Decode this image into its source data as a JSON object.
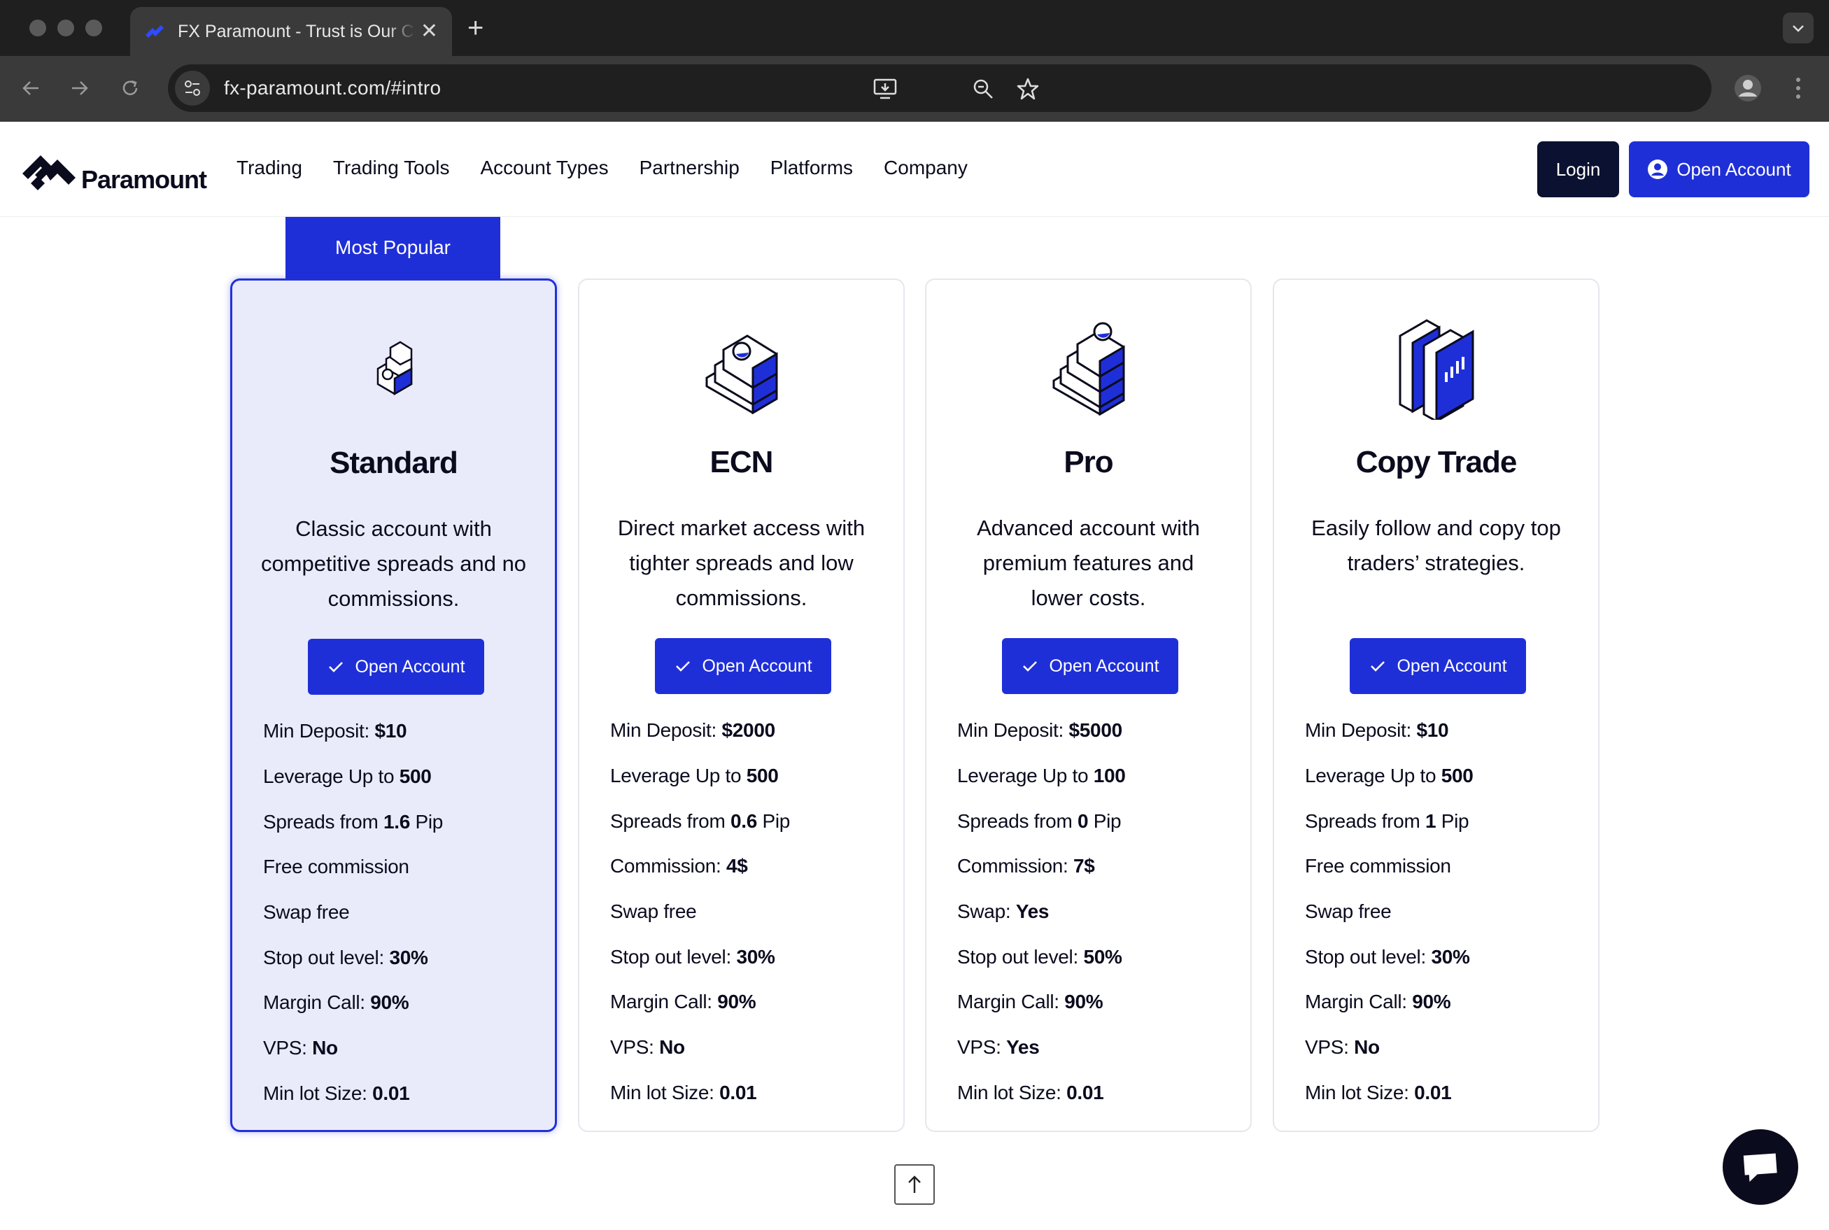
{
  "browser": {
    "tab_title": "FX Paramount - Trust is Our Commitment",
    "url": "fx-paramount.com/#intro"
  },
  "header": {
    "logo_text": "Paramount",
    "nav": [
      "Trading",
      "Trading Tools",
      "Account Types",
      "Partnership",
      "Platforms",
      "Company"
    ],
    "login_label": "Login",
    "open_account_label": "Open Account"
  },
  "popular_tag": "Most Popular",
  "cards": [
    {
      "title": "Standard",
      "description": "Classic account with competitive spreads and no commissions.",
      "button": "Open Account",
      "features": [
        {
          "label": "Min Deposit:",
          "value": "$10",
          "suffix": ""
        },
        {
          "label": "Leverage Up to",
          "value": "500",
          "suffix": ""
        },
        {
          "label": "Spreads from",
          "value": "1.6",
          "suffix": "Pip"
        },
        {
          "label": "Free commission",
          "value": "",
          "suffix": ""
        },
        {
          "label": "Swap free",
          "value": "",
          "suffix": ""
        },
        {
          "label": "Stop out level:",
          "value": "30%",
          "suffix": ""
        },
        {
          "label": "Margin Call:",
          "value": "90%",
          "suffix": ""
        },
        {
          "label": "VPS:",
          "value": "No",
          "suffix": ""
        },
        {
          "label": "Min lot Size:",
          "value": "0.01",
          "suffix": ""
        }
      ]
    },
    {
      "title": "ECN",
      "description": "Direct market access with tighter spreads and low commissions.",
      "button": "Open Account",
      "features": [
        {
          "label": "Min Deposit:",
          "value": "$2000",
          "suffix": ""
        },
        {
          "label": "Leverage Up to",
          "value": "500",
          "suffix": ""
        },
        {
          "label": "Spreads from",
          "value": "0.6",
          "suffix": "Pip"
        },
        {
          "label": "Commission:",
          "value": "4$",
          "suffix": ""
        },
        {
          "label": "Swap free",
          "value": "",
          "suffix": ""
        },
        {
          "label": "Stop out level:",
          "value": "30%",
          "suffix": ""
        },
        {
          "label": "Margin Call:",
          "value": "90%",
          "suffix": ""
        },
        {
          "label": "VPS:",
          "value": "No",
          "suffix": ""
        },
        {
          "label": "Min lot Size:",
          "value": "0.01",
          "suffix": ""
        }
      ]
    },
    {
      "title": "Pro",
      "description": "Advanced account with premium features and lower costs.",
      "button": "Open Account",
      "features": [
        {
          "label": "Min Deposit:",
          "value": "$5000",
          "suffix": ""
        },
        {
          "label": "Leverage Up to",
          "value": "100",
          "suffix": ""
        },
        {
          "label": "Spreads from",
          "value": "0",
          "suffix": "Pip"
        },
        {
          "label": "Commission:",
          "value": "7$",
          "suffix": ""
        },
        {
          "label": "Swap:",
          "value": "Yes",
          "suffix": ""
        },
        {
          "label": "Stop out level:",
          "value": "50%",
          "suffix": ""
        },
        {
          "label": "Margin Call:",
          "value": "90%",
          "suffix": ""
        },
        {
          "label": "VPS:",
          "value": "Yes",
          "suffix": ""
        },
        {
          "label": "Min lot Size:",
          "value": "0.01",
          "suffix": ""
        }
      ]
    },
    {
      "title": "Copy Trade",
      "description": "Easily follow and copy top traders’ strategies.",
      "button": "Open Account",
      "features": [
        {
          "label": "Min Deposit:",
          "value": "$10",
          "suffix": ""
        },
        {
          "label": "Leverage Up to",
          "value": "500",
          "suffix": ""
        },
        {
          "label": "Spreads from",
          "value": "1",
          "suffix": "Pip"
        },
        {
          "label": "Free commission",
          "value": "",
          "suffix": ""
        },
        {
          "label": "Swap free",
          "value": "",
          "suffix": ""
        },
        {
          "label": "Stop out level:",
          "value": "30%",
          "suffix": ""
        },
        {
          "label": "Margin Call:",
          "value": "90%",
          "suffix": ""
        },
        {
          "label": "VPS:",
          "value": "No",
          "suffix": ""
        },
        {
          "label": "Min lot Size:",
          "value": "0.01",
          "suffix": ""
        }
      ]
    }
  ],
  "colors": {
    "brand_blue": "#1f2fd8",
    "dark_navy": "#0b1130",
    "featured_bg": "#e9ebfa"
  },
  "icons": {
    "card_icons": [
      "stairs-small-icon",
      "stairs-ball-icon",
      "stairs-ball-top-icon",
      "chart-cube-icon"
    ]
  }
}
